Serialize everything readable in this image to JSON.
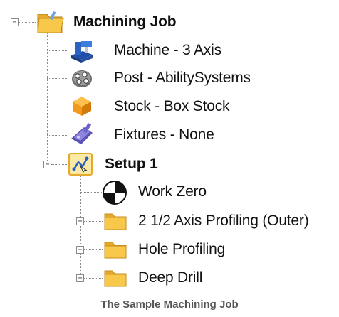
{
  "tree": {
    "root": {
      "label": "Machining Job",
      "icon": "folder-open-icon",
      "expanded": true
    },
    "children": [
      {
        "label": "Machine - 3 Axis",
        "icon": "machine-icon"
      },
      {
        "label": "Post - AbilitySystems",
        "icon": "post-processor-icon"
      },
      {
        "label": "Stock - Box Stock",
        "icon": "stock-box-icon"
      },
      {
        "label": "Fixtures - None",
        "icon": "fixture-icon"
      }
    ],
    "setup": {
      "label": "Setup 1",
      "icon": "setup-icon",
      "expanded": true,
      "children": [
        {
          "label": "Work Zero",
          "icon": "work-zero-icon"
        },
        {
          "label": "2 1/2 Axis Profiling (Outer)",
          "icon": "folder-icon"
        },
        {
          "label": "Hole Profiling",
          "icon": "folder-icon"
        },
        {
          "label": "Deep Drill",
          "icon": "folder-icon"
        }
      ]
    }
  },
  "toggles": {
    "expanded": "−",
    "collapsed": "+"
  },
  "caption": "The Sample Machining Job",
  "colors": {
    "folder": "#f5c043",
    "stock": "#f29a1e",
    "machine": "#2b63c5",
    "fixture": "#6b63c9"
  }
}
